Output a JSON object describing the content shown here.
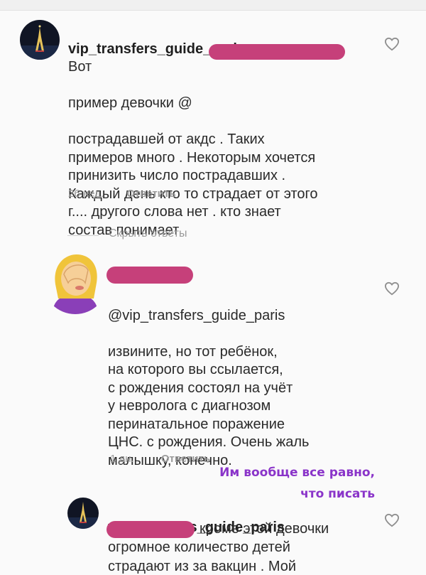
{
  "comments": [
    {
      "username": "vip_transfers_guide_paris",
      "text_first_line": "Вот",
      "text_line2_prefix": "пример девочки @",
      "text_rest": "пострадавшей  от акдс . Таких\nпримеров много . Некоторым хочется\nпринизить число пострадавших .\nКаждый день кто то страдает от этого\nг.... другого слова нет . кто знает\nсостав понимает",
      "age": "26 нед.",
      "reply_label": "Ответить",
      "avatar_icon": "eiffel-tower-night-icon"
    },
    {
      "username_redacted": true,
      "mention": "@vip_transfers_guide_paris",
      "text": "извините, но тот ребёнок,\nна которого вы ссылается,\nс рождения состоял на учёт\nу невролога с диагнозом\nперинатальное поражение\nЦНС. с рождения. Очень жаль\nмалышку, конечно.",
      "age": "1 дн.",
      "reply_label": "Ответить",
      "avatar_icon": "face-palm-emoji-icon"
    },
    {
      "username": "vip_transfers_guide_paris",
      "text_line1_suffix": "кроме этой девочки",
      "text_line2": "огромное количество детей",
      "text_line3_cut": "страдают из за вакцин . Мой",
      "avatar_icon": "eiffel-tower-night-icon"
    }
  ],
  "hide_replies_label": "Скрыть ответы",
  "annotation": "Им вообще все равно,\nчто писать",
  "colors": {
    "redaction": "#c6407a",
    "annotation": "#8a34c9",
    "meta": "#9a9a9a",
    "text": "#262626"
  },
  "icons": {
    "like": "heart-outline-icon"
  }
}
